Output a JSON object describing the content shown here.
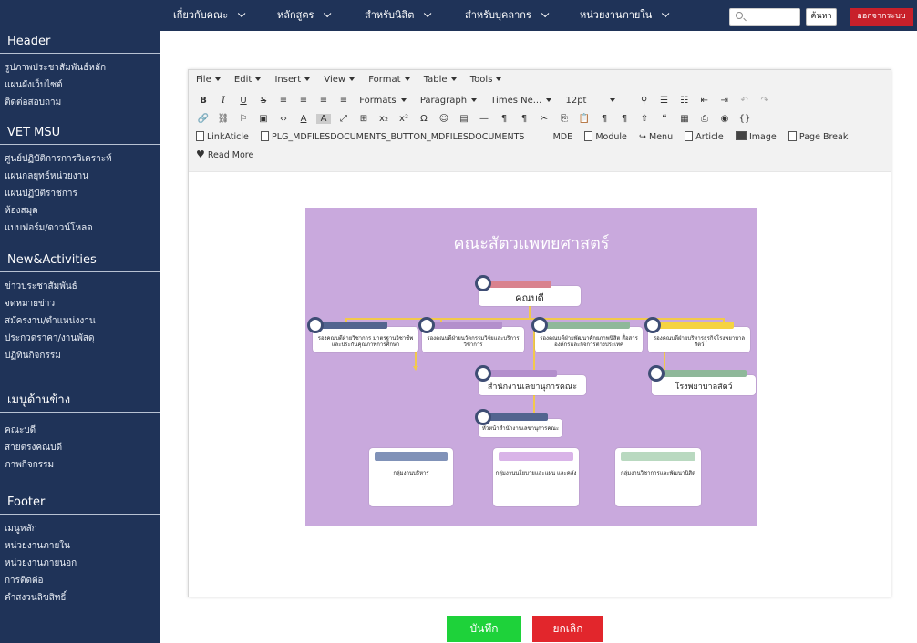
{
  "sidebar": {
    "sections": [
      {
        "title": "Header",
        "items": [
          "รูปภาพประชาสัมพันธ์หลัก",
          "แผนผังเว็บไซต์",
          "ติดต่อสอบถาม"
        ]
      },
      {
        "title": "VET MSU",
        "items": [
          "ศูนย์ปฏิบัติการการวิเคราะห์",
          "แผนกลยุทธ์หน่วยงาน",
          "แผนปฏิบัติราชการ",
          "ห้องสมุด",
          "แบบฟอร์ม/ดาวน์โหลด"
        ]
      },
      {
        "title": "New&Activities",
        "items": [
          "ข่าวประชาสัมพันธ์",
          "จดหมายข่าว",
          "สมัครงาน/ตำแหน่งงาน",
          "ประกวดราคา/งานพัสดุ",
          "ปฏิทินกิจกรรม"
        ]
      },
      {
        "title": "เมนูด้านข้าง",
        "items": [
          "คณะบดี",
          "สายตรงคณบดี",
          "ภาพกิจกรรม"
        ]
      },
      {
        "title": "Footer",
        "items": [
          "เมนูหลัก",
          "หน่วยงานภายใน",
          "หน่วยงานภายนอก",
          "การติดต่อ",
          "คำสงวนลิขสิทธิ์"
        ]
      }
    ]
  },
  "topnav": {
    "items": [
      "เกี่ยวกับคณะ",
      "หลักสูตร",
      "สำหรับนิสิต",
      "สำหรับบุคลากร",
      "หน่วยงานภายใน"
    ],
    "search_value": "",
    "search_placeholder": "",
    "search_button": "ค้นหา",
    "logout_button": "ออกจากระบบ"
  },
  "editor": {
    "menus": [
      "File",
      "Edit",
      "Insert",
      "View",
      "Format",
      "Table",
      "Tools"
    ],
    "row1": {
      "formats": "Formats",
      "paragraph": "Paragraph",
      "font": "Times Ne...",
      "size": "12pt"
    },
    "row3": {
      "link_article": "LinkAticle",
      "mdf_button": "PLG_MDFILESDOCUMENTS_BUTTON_MDFILESDOCUMENTS",
      "mde": "MDE",
      "module": "Module",
      "menu": "Menu",
      "article": "Article",
      "image": "Image",
      "page_break": "Page Break"
    },
    "read_more": "Read More"
  },
  "orgchart": {
    "title": "คณะสัตวแพทยศาสตร์",
    "dean": "คณบดี",
    "vp1": "รองคณบดีฝ่ายวิชาการ มาตรฐานวิชาชีพ และประกันคุณภาพการศึกษา",
    "vp2": "รองคณบดีฝ่ายนวัตกรรมวิจัยและบริการวิชาการ",
    "vp3": "รองคณบดีฝ่ายพัฒนาศักยภาพนิสิต สื่อสารองค์กรและกิจการต่างประเทศ",
    "vp4": "รองคณบดีฝ่ายบริหารธุรกิจโรงพยาบาลสัตว์",
    "office": "สำนักงานเลขานุการคณะ",
    "hospital": "โรงพยาบาลสัตว์",
    "office_head": "หัวหน้าสำนักงานเลขานุการคณะ",
    "group1": "กลุ่มงานบริหาร",
    "group2": "กลุ่มงานนโยบายและแผน และคลัง",
    "group3": "กลุ่มงานวิชาการและพัฒนานิสิต"
  },
  "buttons": {
    "save": "บันทึก",
    "cancel": "ยกเลิก"
  },
  "colors": {
    "sidebar_bg": "#1f3358",
    "chart_bg": "#c9a9dd",
    "save": "#1ed23a",
    "cancel": "#e2262c",
    "logout": "#c8202a"
  }
}
